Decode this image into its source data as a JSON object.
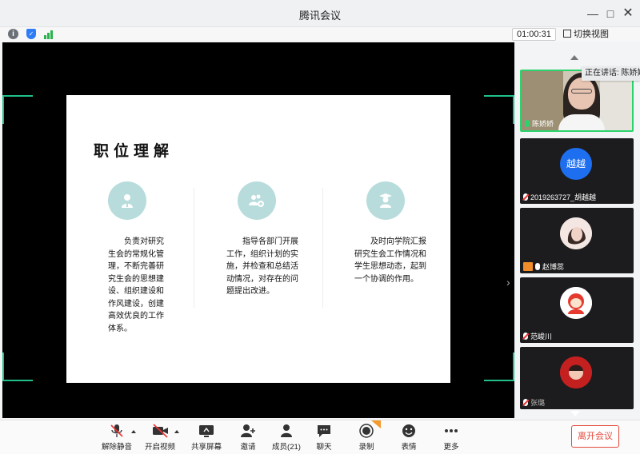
{
  "window": {
    "title": "腾讯会议"
  },
  "status": {
    "timer": "01:00:31",
    "switch_view": "切换视图"
  },
  "slide": {
    "title": "职位理解",
    "columns": [
      {
        "icon": "person-icon",
        "text": "负责对研究生会的常规化管理，不断完善研究生会的思想建设、组织建设和作风建设，创建高效优良的工作体系。"
      },
      {
        "icon": "team-add-icon",
        "text": "指导各部门开展工作，组织计划的实施，并检查和总结活动情况，对存在的问题提出改进。"
      },
      {
        "icon": "graduate-icon",
        "text": "及时向学院汇报研究生会工作情况和学生思想动态，起到一个协调的作用。"
      }
    ]
  },
  "panel": {
    "speaking_label": "正在讲话: 陈娇娇",
    "participants": [
      {
        "name": "陈娇娇",
        "mic": "on"
      },
      {
        "name": "2019263727_胡越越",
        "avatar_text": "越越",
        "mic": "off"
      },
      {
        "name": "赵博蕊",
        "mic": "on",
        "host": true
      },
      {
        "name": "范峻川",
        "mic": "off"
      },
      {
        "name": "张璐",
        "mic": "off"
      }
    ]
  },
  "toolbar": {
    "unmute": "解除静音",
    "start_video": "开启视频",
    "share_screen": "共享屏幕",
    "invite": "邀请",
    "members": "成员(21)",
    "chat": "聊天",
    "record": "录制",
    "reactions": "表情",
    "more": "更多",
    "leave": "离开会议"
  },
  "colors": {
    "accent_green": "#21c08b",
    "leave_red": "#e24a3b",
    "teal_circle": "#b7dcdb",
    "blue_avatar": "#1e6ff0"
  }
}
